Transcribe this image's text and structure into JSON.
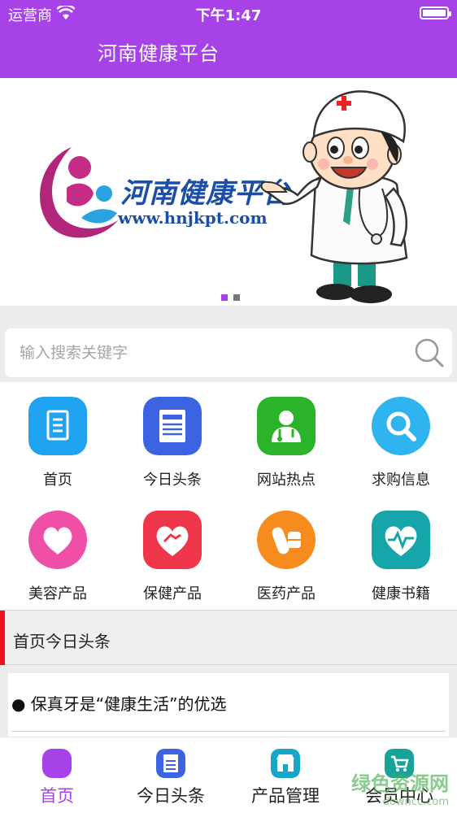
{
  "status_bar": {
    "carrier": "运营商",
    "time": "下午1:47"
  },
  "nav": {
    "title": "河南健康平台"
  },
  "banner": {
    "logo_text": "河南健康平台",
    "logo_url": "www.hnjkpt.com",
    "page_count": 2,
    "active_page": 1
  },
  "search": {
    "placeholder": "输入搜索关键字"
  },
  "grid": {
    "items": [
      {
        "label": "首页",
        "icon": "home-icon",
        "color": "#1fa2ef"
      },
      {
        "label": "今日头条",
        "icon": "news-icon",
        "color": "#3c63e2"
      },
      {
        "label": "网站热点",
        "icon": "doctor-icon",
        "color": "#2bb32a"
      },
      {
        "label": "求购信息",
        "icon": "search-icon",
        "color": "#2fb4f0"
      },
      {
        "label": "美容产品",
        "icon": "heart-icon",
        "color": "#f04fa8"
      },
      {
        "label": "保健产品",
        "icon": "heart-hand-icon",
        "color": "#f0364a"
      },
      {
        "label": "医药产品",
        "icon": "pill-icon",
        "color": "#f68b1e"
      },
      {
        "label": "健康书籍",
        "icon": "pulse-heart-icon",
        "color": "#16a6a9"
      }
    ]
  },
  "section": {
    "title": "首页今日头条"
  },
  "news": [
    {
      "title": "● 保真牙是“健康生活”的优选"
    }
  ],
  "tabs": [
    {
      "label": "首页",
      "icon": "home-tab-icon",
      "color": "#a642e8",
      "active": true
    },
    {
      "label": "今日头条",
      "icon": "news-tab-icon",
      "color": "#3c63e2",
      "active": false
    },
    {
      "label": "产品管理",
      "icon": "store-tab-icon",
      "color": "#16a6c9",
      "active": false
    },
    {
      "label": "会员中心",
      "icon": "cart-tab-icon",
      "color": "#16a39a",
      "active": false
    }
  ],
  "watermark": {
    "text": "绿色资源网",
    "sub": "downcc.com"
  },
  "colors": {
    "brand": "#a642e8",
    "accent_bar": "#e8141d"
  }
}
